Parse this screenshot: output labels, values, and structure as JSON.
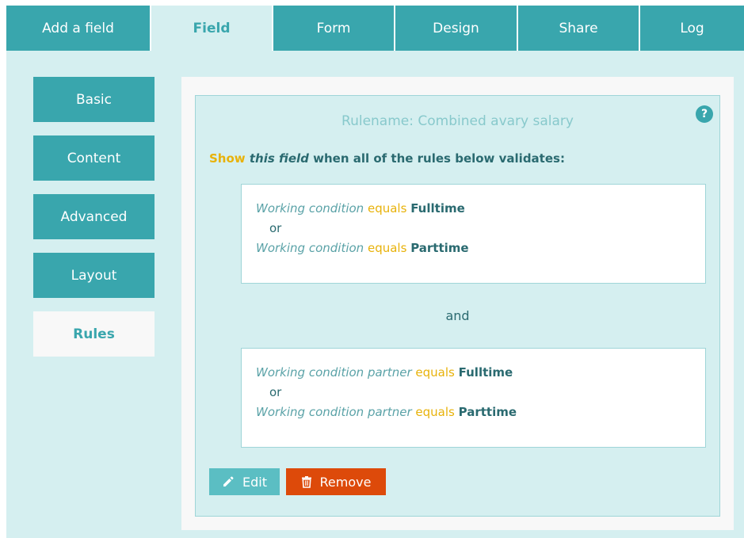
{
  "tabs": [
    {
      "label": "Add a field"
    },
    {
      "label": "Field"
    },
    {
      "label": "Form"
    },
    {
      "label": "Design"
    },
    {
      "label": "Share"
    },
    {
      "label": "Log"
    }
  ],
  "sidebar": {
    "items": [
      {
        "label": "Basic"
      },
      {
        "label": "Content"
      },
      {
        "label": "Advanced"
      },
      {
        "label": "Layout"
      },
      {
        "label": "Rules"
      }
    ]
  },
  "rule": {
    "title": "Rulename: Combined avary salary",
    "help": "?",
    "intro_show": "Show",
    "intro_field": "this field",
    "intro_rest": "when all of the rules below validates:",
    "groups": [
      {
        "conditions": [
          {
            "field": "Working condition",
            "op": "equals",
            "value": "Fulltime"
          },
          {
            "field": "Working condition",
            "op": "equals",
            "value": "Parttime"
          }
        ],
        "joiner": "or"
      },
      {
        "conditions": [
          {
            "field": "Working condition partner",
            "op": "equals",
            "value": "Fulltime"
          },
          {
            "field": "Working condition partner",
            "op": "equals",
            "value": "Parttime"
          }
        ],
        "joiner": "or"
      }
    ],
    "group_joiner": "and"
  },
  "actions": {
    "edit_label": "Edit",
    "remove_label": "Remove"
  },
  "colors": {
    "accent": "#39a6ad",
    "background": "#d5eff0",
    "highlight": "#e8b20a",
    "danger": "#dd4a0a"
  }
}
